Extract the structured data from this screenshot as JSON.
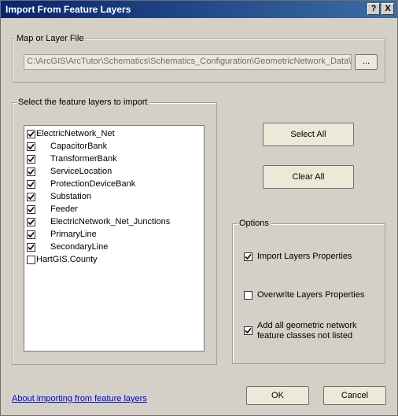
{
  "window": {
    "title": "Import From Feature Layers",
    "help_button": "?",
    "close_button": "X"
  },
  "map_file": {
    "group_label": "Map or Layer File",
    "path": "C:\\ArcGIS\\ArcTutor\\Schematics\\Schematics_Configuration\\GeometricNetwork_Data\\W",
    "browse_label": "..."
  },
  "layers": {
    "group_label": "Select the feature layers to import",
    "items": [
      {
        "label": "ElectricNetwork_Net",
        "checked": true
      },
      {
        "label": "CapacitorBank",
        "checked": true
      },
      {
        "label": "TransformerBank",
        "checked": true
      },
      {
        "label": "ServiceLocation",
        "checked": true
      },
      {
        "label": "ProtectionDeviceBank",
        "checked": true
      },
      {
        "label": "Substation",
        "checked": true
      },
      {
        "label": "Feeder",
        "checked": true
      },
      {
        "label": "ElectricNetwork_Net_Junctions",
        "checked": true
      },
      {
        "label": "PrimaryLine",
        "checked": true
      },
      {
        "label": "SecondaryLine",
        "checked": true
      },
      {
        "label": "HartGIS.County",
        "checked": false
      }
    ],
    "select_all_label": "Select All",
    "clear_all_label": "Clear All"
  },
  "options": {
    "group_label": "Options",
    "import_properties": {
      "label": "Import Layers Properties",
      "checked": true
    },
    "overwrite_properties": {
      "label": "Overwrite Layers Properties",
      "checked": false
    },
    "add_all_classes": {
      "line1": "Add all geometric network",
      "line2": "feature classes not listed",
      "checked": true
    }
  },
  "footer": {
    "help_link": "About importing from feature layers",
    "ok_label": "OK",
    "cancel_label": "Cancel"
  }
}
